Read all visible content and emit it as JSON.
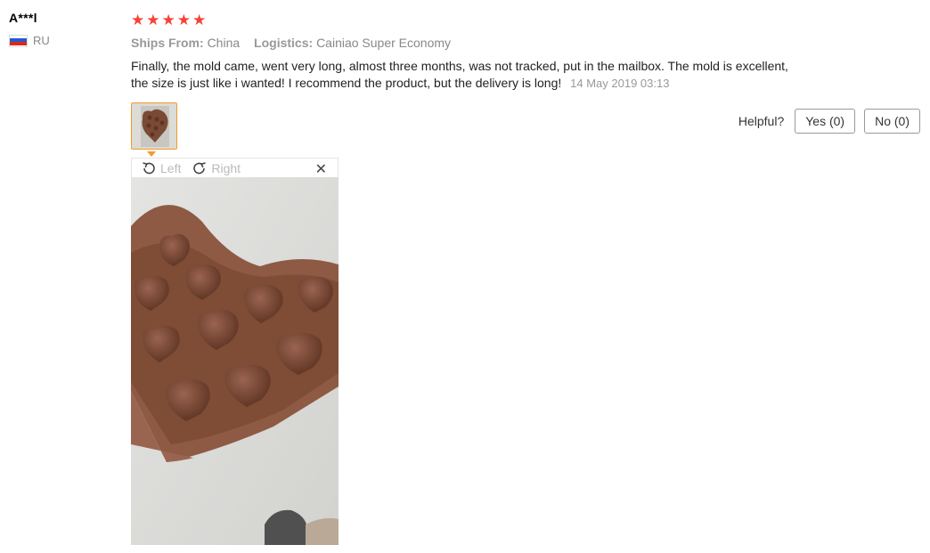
{
  "user": {
    "name": "A***l",
    "country": "RU"
  },
  "review": {
    "rating": 5,
    "ships_from_label": "Ships From:",
    "ships_from_value": "China",
    "logistics_label": "Logistics:",
    "logistics_value": "Cainiao Super Economy",
    "text": "Finally, the mold came, went very long, almost three months, was not tracked, put in the mailbox. The mold is excellent, the size is just like i wanted! I recommend the product, but the delivery is long!",
    "date": "14 May 2019 03:13"
  },
  "helpful": {
    "label": "Helpful?",
    "yes_label": "Yes (0)",
    "no_label": "No (0)"
  },
  "viewer": {
    "rotate_left_label": "Left",
    "rotate_right_label": "Right",
    "close_icon": "close-icon"
  },
  "colors": {
    "star": "#f44336",
    "thumb_border": "#f39a2e",
    "chocolate": "#7a4a34"
  }
}
